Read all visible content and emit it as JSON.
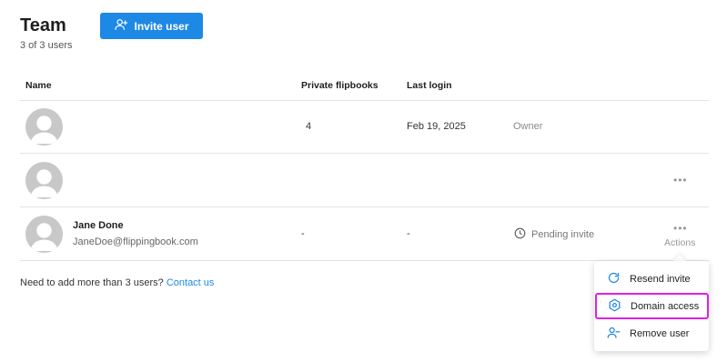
{
  "header": {
    "title": "Team",
    "subtitle": "3 of 3 users",
    "invite_label": "Invite user"
  },
  "table": {
    "columns": [
      "Name",
      "Private flipbooks",
      "Last login"
    ],
    "rows": [
      {
        "name": "",
        "email": "",
        "flipbooks": "4",
        "last_login": "Feb 19, 2025",
        "role": "Owner"
      },
      {
        "name": "",
        "email": "",
        "flipbooks": "",
        "last_login": "",
        "role": "",
        "more": "•••"
      },
      {
        "name": "Jane Done",
        "email": "JaneDoe@flippingbook.com",
        "flipbooks": "-",
        "last_login": "-",
        "role": "Pending invite",
        "more": "•••",
        "actions_label": "Actions"
      }
    ]
  },
  "footer": {
    "text": "Need to add more than 3 users?",
    "link": "Contact us"
  },
  "menu": {
    "items": [
      {
        "label": "Resend invite",
        "icon": "refresh-icon"
      },
      {
        "label": "Domain access",
        "icon": "hexagon-settings-icon",
        "highlighted": true
      },
      {
        "label": "Remove user",
        "icon": "user-minus-icon"
      }
    ]
  },
  "colors": {
    "accent": "#1e88e5",
    "highlight": "#e020e0",
    "avatar": "#c8c8c8"
  }
}
